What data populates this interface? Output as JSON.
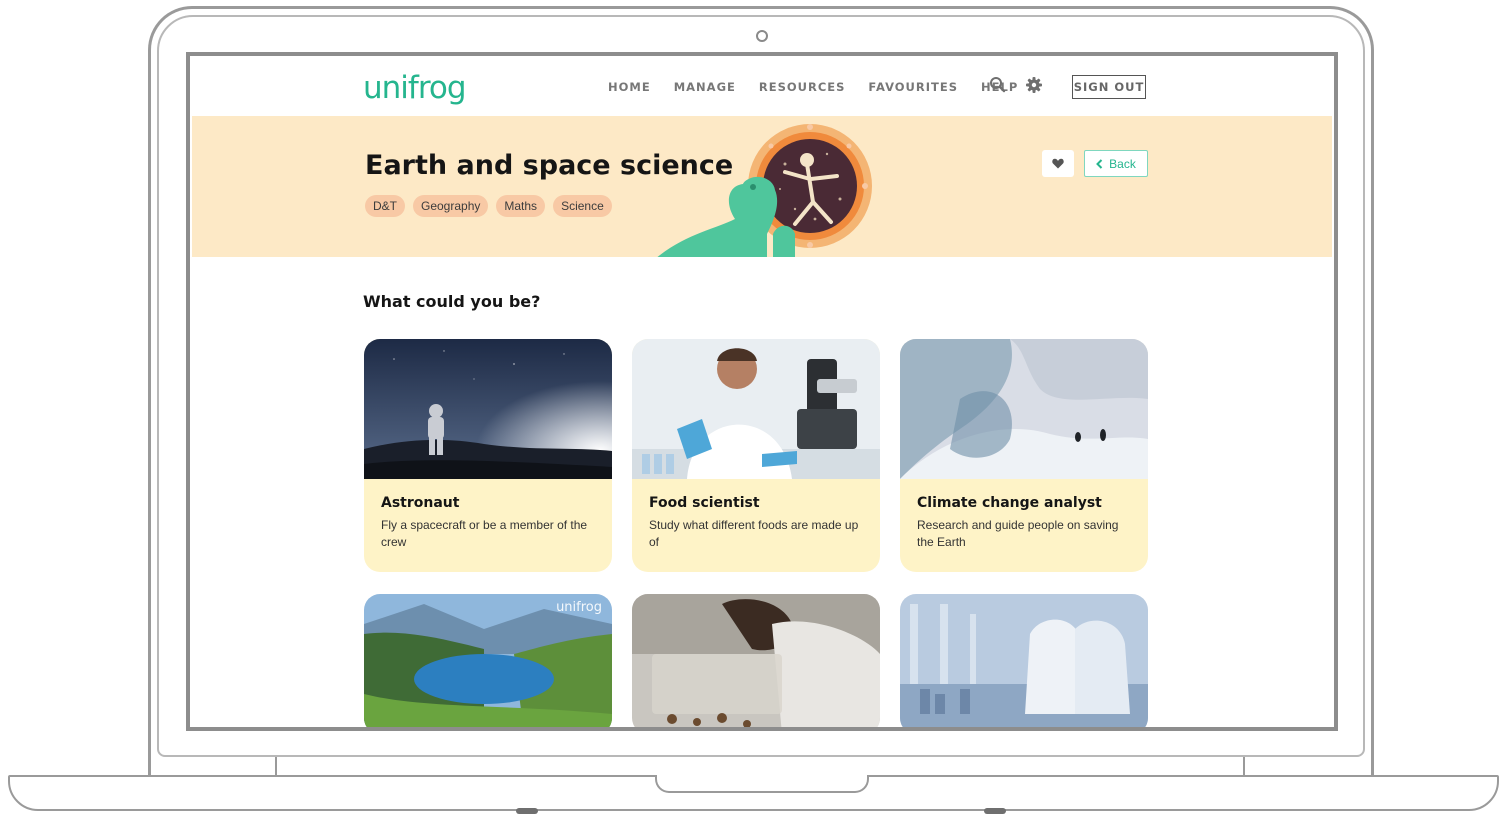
{
  "nav": {
    "logo": "unifrog",
    "links": [
      "HOME",
      "MANAGE",
      "RESOURCES",
      "FAVOURITES",
      "HELP"
    ],
    "sign_out": "SIGN OUT"
  },
  "hero": {
    "title": "Earth and space science",
    "tags": [
      "D&T",
      "Geography",
      "Maths",
      "Science"
    ],
    "back_label": "Back"
  },
  "section": {
    "title": "What could you be?"
  },
  "careers": [
    {
      "title": "Astronaut",
      "description": "Fly a spacecraft or be a member of the crew"
    },
    {
      "title": "Food scientist",
      "description": "Study what different foods are made up of"
    },
    {
      "title": "Climate change analyst",
      "description": "Research and guide people on saving the Earth"
    }
  ],
  "image_watermark": "unifrog",
  "colors": {
    "brand_green": "#25b58e",
    "hero_bg": "#fde9c6",
    "tag_bg": "#f8c9a5",
    "card_bg": "#fef3c7"
  }
}
